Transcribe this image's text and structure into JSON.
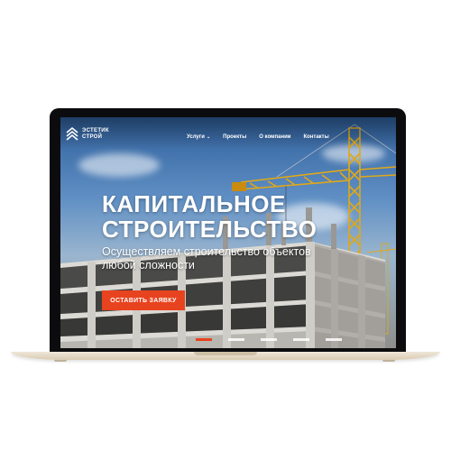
{
  "site": {
    "logo": {
      "line1": "ЭСТЕТИК",
      "line2": "СТРОЙ",
      "icon": "stairs-logo-icon"
    },
    "nav": [
      {
        "label": "Услуги",
        "has_dropdown": true
      },
      {
        "label": "Проекты",
        "has_dropdown": false
      },
      {
        "label": "О компании",
        "has_dropdown": false
      },
      {
        "label": "Контакты",
        "has_dropdown": false
      }
    ],
    "hero": {
      "title_line1": "КАПИТАЛЬНОЕ",
      "title_line2": "СТРОИТЕЛЬСТВО",
      "subtitle": "Осуществляем строительство объектов любой сложности",
      "cta": "ОСТАВИТЬ ЗАЯВКУ",
      "slides": 5,
      "active_slide": 1
    },
    "colors": {
      "accent": "#e8431f",
      "crane": "#e0a818",
      "sky": "#4f7fb8"
    }
  }
}
